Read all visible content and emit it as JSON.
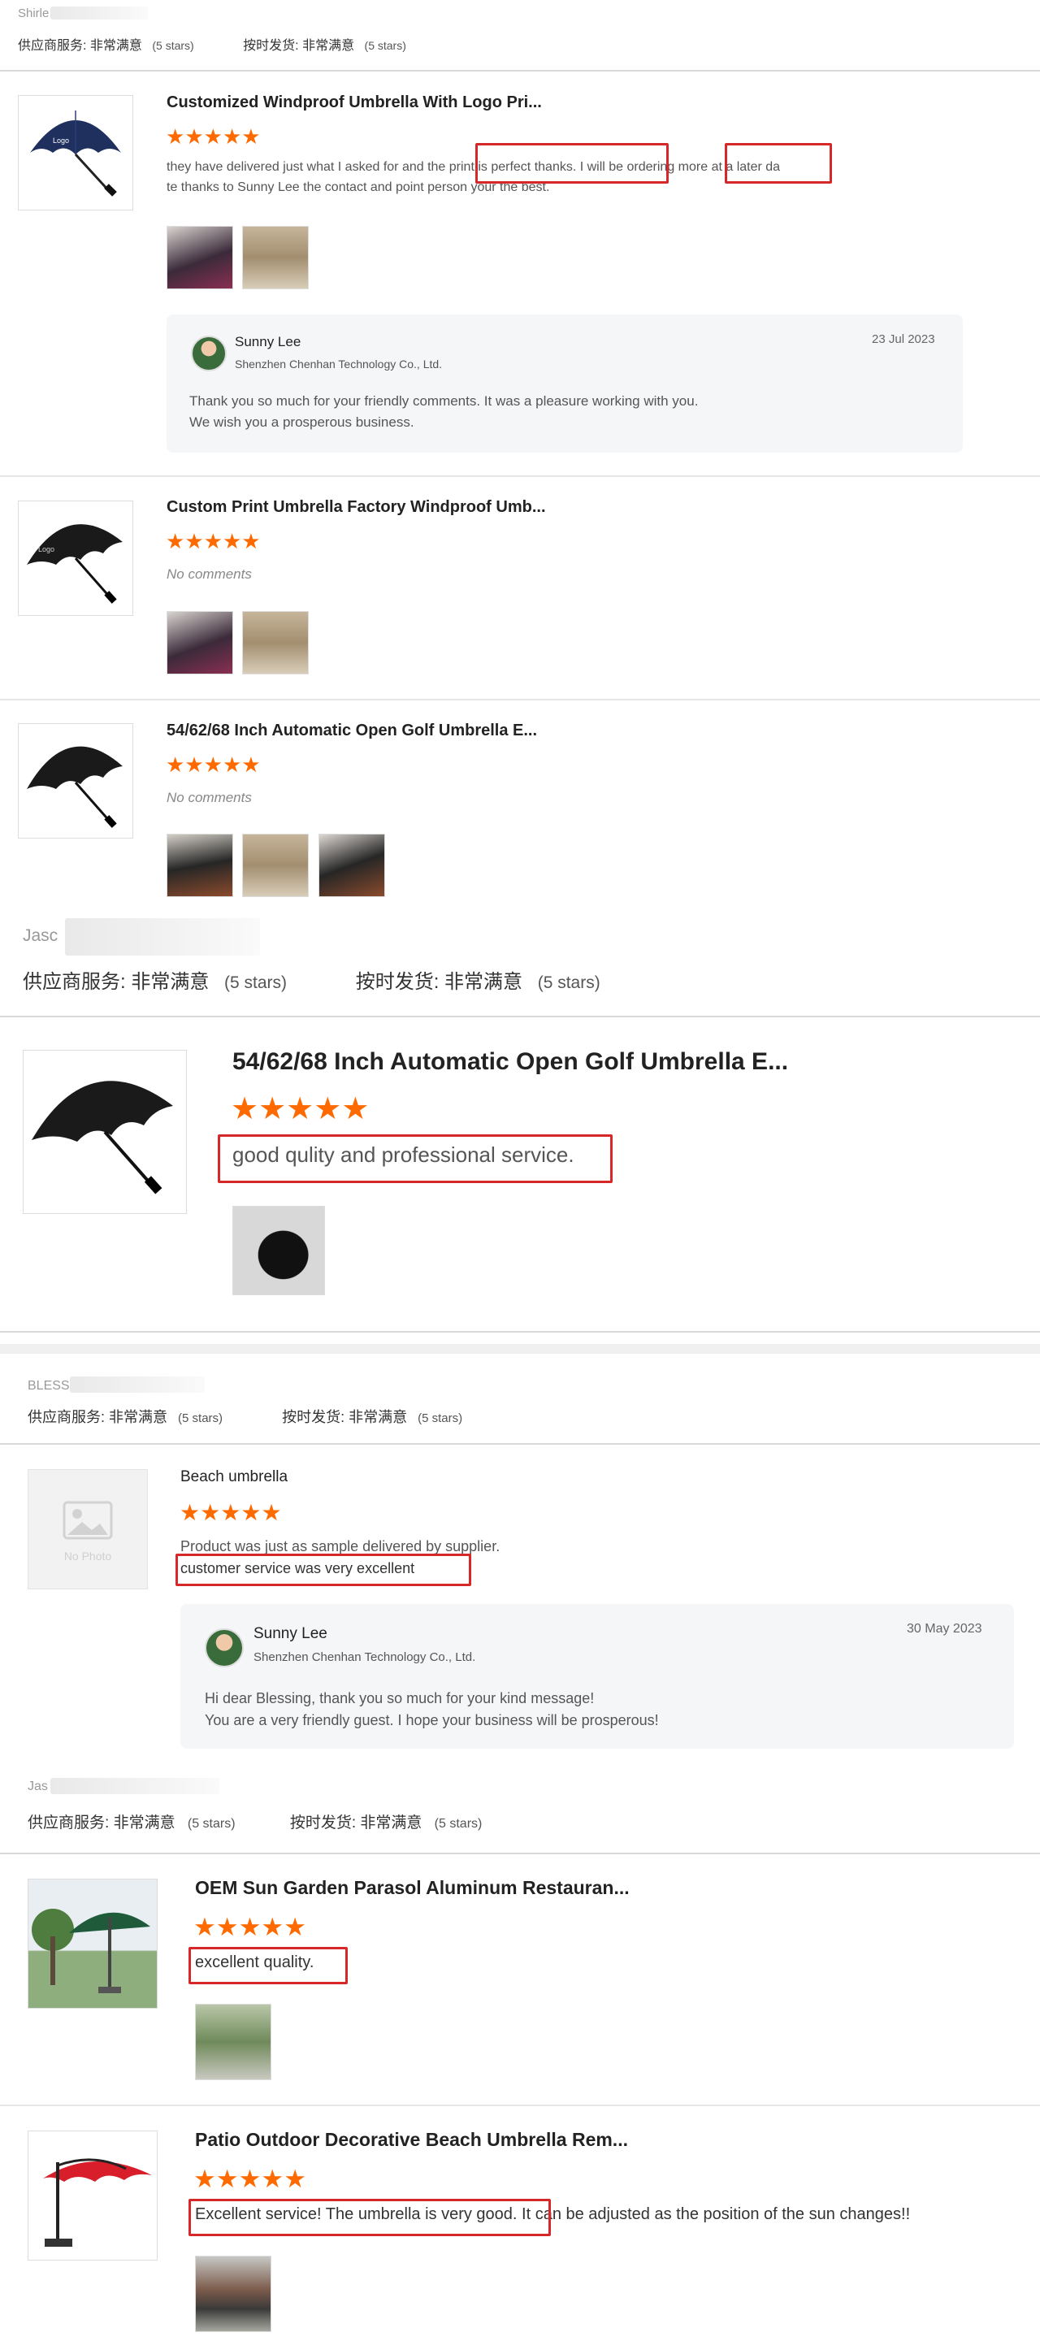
{
  "labels": {
    "supplier_service": "供应商服务:",
    "very_satisfied": "非常满意",
    "five_stars": "(5 stars)",
    "on_time_delivery": "按时发货:",
    "no_comments": "No comments",
    "no_photo": "No Photo"
  },
  "colors": {
    "star": "#ff6a00",
    "highlight_box": "#d62828"
  },
  "icons": {
    "star": "★"
  },
  "block1": {
    "reviewer": "Shirle",
    "reviews": [
      {
        "title": "Customized Windproof Umbrella With Logo Pri...",
        "rating": 5,
        "text_line1": "they have delivered just what I asked for and the print is perfect thanks. I will be ordering more at a later da",
        "text_line2": "te thanks to Sunny Lee the contact and point person your the best.",
        "reply": {
          "name": "Sunny Lee",
          "company": "Shenzhen Chenhan Technology Co., Ltd.",
          "date": "23 Jul 2023",
          "line1": "Thank you so much for your friendly comments. It was a pleasure working with you.",
          "line2": "We wish you a prosperous business."
        }
      },
      {
        "title": "Custom Print Umbrella Factory Windproof Umb...",
        "rating": 5
      },
      {
        "title": "54/62/68 Inch Automatic Open Golf Umbrella E...",
        "rating": 5
      }
    ]
  },
  "block2": {
    "reviewer": "Jasc",
    "review": {
      "title": "54/62/68 Inch Automatic Open Golf Umbrella E...",
      "rating": 5,
      "text": "good qulity and professional service."
    }
  },
  "block3": {
    "reviewer": "BLESS",
    "review": {
      "title": "Beach umbrella",
      "rating": 5,
      "text_line1": "Product was just as sample delivered by supplier.",
      "text_line2": "customer service was very excellent",
      "reply": {
        "name": "Sunny Lee",
        "company": "Shenzhen Chenhan Technology Co., Ltd.",
        "date": "30 May 2023",
        "line1": "Hi dear Blessing, thank you so much for your kind message!",
        "line2": "You are a very friendly guest. I hope your business will be prosperous!"
      }
    }
  },
  "block4": {
    "reviewer": "Jas",
    "reviews": [
      {
        "title": "OEM Sun Garden Parasol Aluminum Restauran...",
        "rating": 5,
        "text": "excellent quality."
      },
      {
        "title": "Patio Outdoor Decorative Beach Umbrella Rem...",
        "rating": 5,
        "text": "Excellent service! The umbrella is very good. It can be adjusted as the position of the sun changes!!"
      }
    ]
  }
}
